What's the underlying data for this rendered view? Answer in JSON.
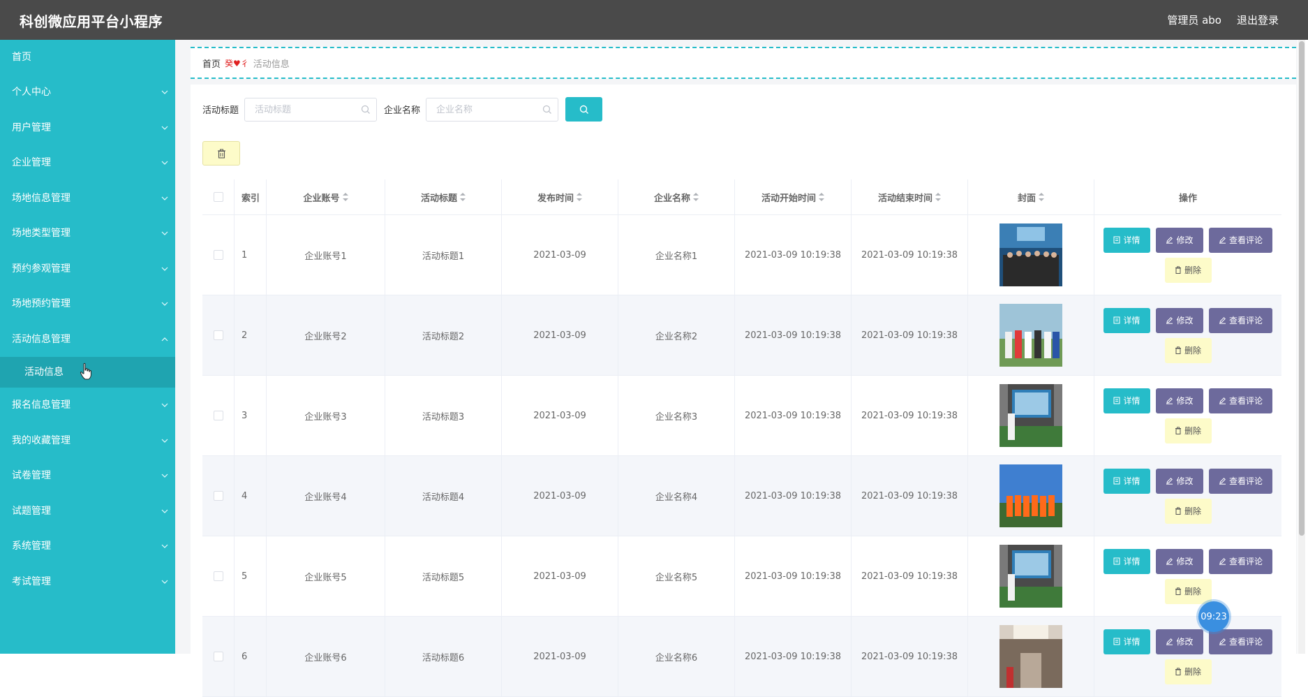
{
  "header": {
    "app_title": "科创微应用平台小程序",
    "user_label": "管理员 abo",
    "logout_label": "退出登录"
  },
  "sidebar": {
    "home": "首页",
    "items": [
      {
        "label": "个人中心"
      },
      {
        "label": "用户管理"
      },
      {
        "label": "企业管理"
      },
      {
        "label": "场地信息管理"
      },
      {
        "label": "场地类型管理"
      },
      {
        "label": "预约参观管理"
      },
      {
        "label": "场地预约管理"
      },
      {
        "label": "活动信息管理"
      },
      {
        "label": "报名信息管理"
      },
      {
        "label": "我的收藏管理"
      },
      {
        "label": "试卷管理"
      },
      {
        "label": "试题管理"
      },
      {
        "label": "系统管理"
      },
      {
        "label": "考试管理"
      }
    ],
    "active_sub": "活动信息"
  },
  "breadcrumb": {
    "home": "首页",
    "current": "活动信息",
    "separator": "癸♥彳"
  },
  "search": {
    "title_label": "活动标题",
    "title_placeholder": "活动标题",
    "company_label": "企业名称",
    "company_placeholder": "企业名称"
  },
  "table": {
    "headers": [
      "索引",
      "企业账号",
      "活动标题",
      "发布时间",
      "企业名称",
      "活动开始时间",
      "活动结束时间",
      "封面",
      "操作"
    ],
    "rows": [
      {
        "index": "1",
        "account": "企业账号1",
        "title": "活动标题1",
        "publish": "2021-03-09",
        "company": "企业名称1",
        "start": "2021-03-09 10:19:38",
        "end": "2021-03-09 10:19:38"
      },
      {
        "index": "2",
        "account": "企业账号2",
        "title": "活动标题2",
        "publish": "2021-03-09",
        "company": "企业名称2",
        "start": "2021-03-09 10:19:38",
        "end": "2021-03-09 10:19:38"
      },
      {
        "index": "3",
        "account": "企业账号3",
        "title": "活动标题3",
        "publish": "2021-03-09",
        "company": "企业名称3",
        "start": "2021-03-09 10:19:38",
        "end": "2021-03-09 10:19:38"
      },
      {
        "index": "4",
        "account": "企业账号4",
        "title": "活动标题4",
        "publish": "2021-03-09",
        "company": "企业名称4",
        "start": "2021-03-09 10:19:38",
        "end": "2021-03-09 10:19:38"
      },
      {
        "index": "5",
        "account": "企业账号5",
        "title": "活动标题5",
        "publish": "2021-03-09",
        "company": "企业名称5",
        "start": "2021-03-09 10:19:38",
        "end": "2021-03-09 10:19:38"
      },
      {
        "index": "6",
        "account": "企业账号6",
        "title": "活动标题6",
        "publish": "2021-03-09",
        "company": "企业名称6",
        "start": "2021-03-09 10:19:38",
        "end": "2021-03-09 10:19:38"
      }
    ],
    "actions": {
      "detail": "详情",
      "edit": "修改",
      "comment": "查看评论",
      "delete": "删除"
    }
  },
  "clock": "09:23",
  "colors": {
    "primary": "#26bcc9",
    "purple": "#6d6a9c",
    "yellow": "#fdfbc9",
    "header": "#4a4a4a"
  },
  "icons": [
    "search-icon",
    "delete-icon",
    "detail-icon",
    "edit-icon",
    "chevron-down-icon",
    "chevron-up-icon",
    "hand-cursor-icon"
  ]
}
